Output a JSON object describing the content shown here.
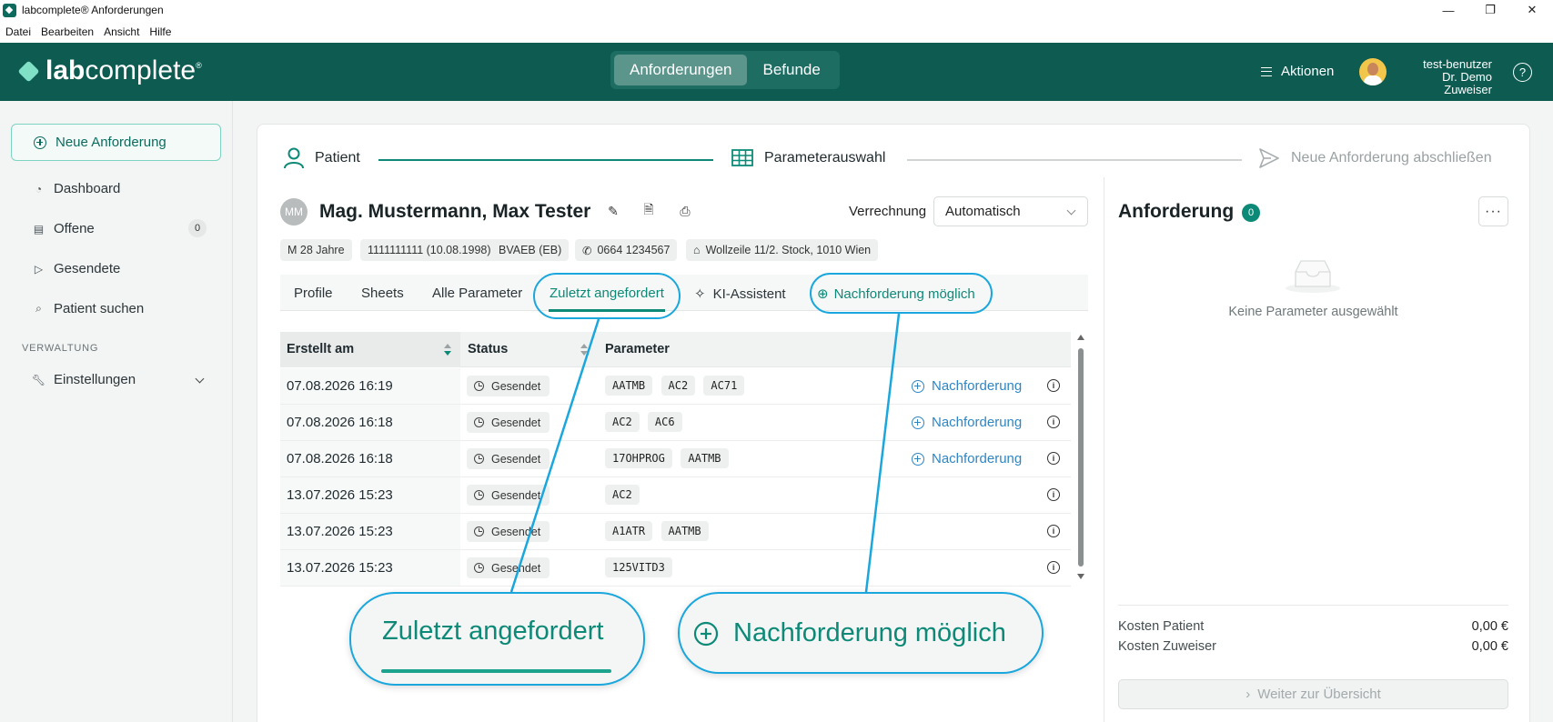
{
  "window": {
    "title": "labcomplete® Anforderungen",
    "minimize": "—",
    "maximize": "❐",
    "close": "✕"
  },
  "menu": [
    "Datei",
    "Bearbeiten",
    "Ansicht",
    "Hilfe"
  ],
  "header": {
    "logo_bold": "lab",
    "logo_rest": "complete",
    "logo_reg": "®",
    "tabs": [
      "Anforderungen",
      "Befunde"
    ],
    "active_tab": "Anforderungen",
    "actions_label": "Aktionen",
    "user_name": "test-benutzer",
    "user_org": "Dr. Demo Zuweiser",
    "help": "?"
  },
  "sidebar": {
    "new_request": "Neue Anforderung",
    "items": [
      {
        "label": "Dashboard",
        "icon": "gauge-icon"
      },
      {
        "label": "Offene",
        "icon": "clipboard-icon",
        "badge": "0"
      },
      {
        "label": "Gesendete",
        "icon": "send-icon"
      },
      {
        "label": "Patient suchen",
        "icon": "search-icon"
      }
    ],
    "section": "VERWALTUNG",
    "settings": "Einstellungen"
  },
  "stepper": {
    "steps": [
      "Patient",
      "Parameterauswahl",
      "Neue Anforderung abschließen"
    ]
  },
  "patient": {
    "initials": "MM",
    "name": "Mag. Mustermann, Max Tester",
    "billing_label": "Verrechnung",
    "billing_value": "Automatisch",
    "chips": [
      "M 28 Jahre",
      "1111111111 (10.08.1998)",
      "BVAEB (EB)",
      "0664 1234567",
      "Wollzeile 11/2. Stock, 1010 Wien"
    ]
  },
  "tabs": [
    "Profile",
    "Sheets",
    "Alle Parameter",
    "Zuletzt angefordert",
    "KI-Assistent",
    "Nachforderung möglich"
  ],
  "active_tab": "Zuletzt angefordert",
  "table": {
    "columns": [
      "Erstellt am",
      "Status",
      "Parameter"
    ],
    "rows": [
      {
        "date": "07.08.2026 16:19",
        "status": "Gesendet",
        "params": [
          "AATMB",
          "AC2",
          "AC71"
        ],
        "action": "Nachforderung"
      },
      {
        "date": "07.08.2026 16:18",
        "status": "Gesendet",
        "params": [
          "AC2",
          "AC6"
        ],
        "action": "Nachforderung"
      },
      {
        "date": "07.08.2026 16:18",
        "status": "Gesendet",
        "params": [
          "17OHPROG",
          "AATMB"
        ],
        "action": "Nachforderung"
      },
      {
        "date": "13.07.2026 15:23",
        "status": "Gesendet",
        "params": [
          "AC2"
        ],
        "action": ""
      },
      {
        "date": "13.07.2026 15:23",
        "status": "Gesendet",
        "params": [
          "A1ATR",
          "AATMB"
        ],
        "action": ""
      },
      {
        "date": "13.07.2026 15:23",
        "status": "Gesendet",
        "params": [
          "125VITD3"
        ],
        "action": ""
      }
    ]
  },
  "request_panel": {
    "title": "Anforderung",
    "count": "0",
    "more": "···",
    "empty": "Keine Parameter ausgewählt",
    "cost_patient_label": "Kosten Patient",
    "cost_patient_value": "0,00 €",
    "cost_referrer_label": "Kosten Zuweiser",
    "cost_referrer_value": "0,00 €",
    "continue": "Weiter zur Übersicht"
  },
  "callouts": {
    "left": "Zuletzt angefordert",
    "right": "Nachforderung möglich"
  },
  "colors": {
    "brand": "#0d5b51",
    "accent": "#0d8a77",
    "link": "#2f86c4",
    "callout": "#1aa7dd"
  }
}
